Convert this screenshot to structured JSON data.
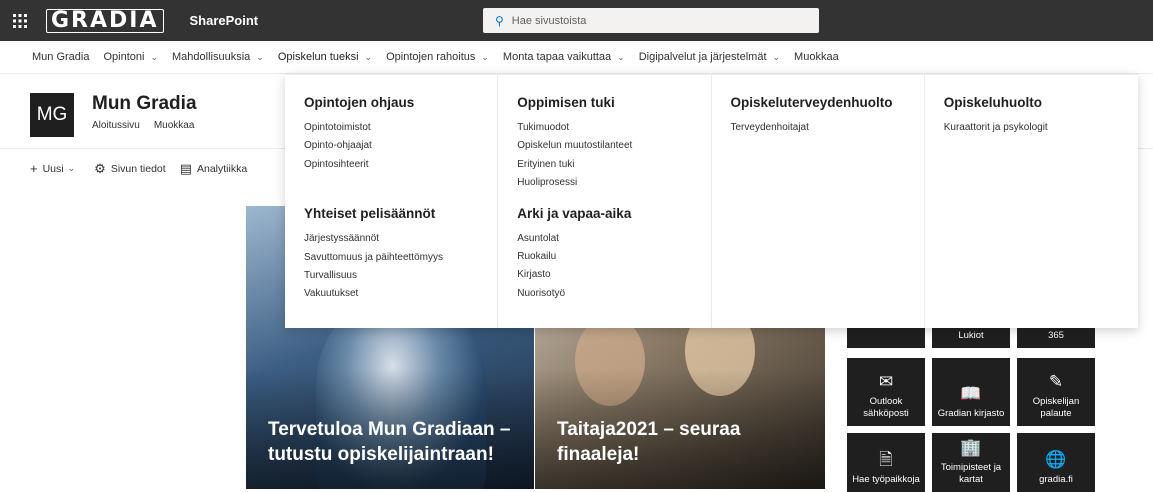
{
  "suitebar": {
    "logo_text": "GRADIA",
    "app_name": "SharePoint",
    "search_placeholder": "Hae sivustoista",
    "bg_color": "#333333"
  },
  "hubnav": {
    "items": [
      {
        "label": "Mun Gradia",
        "has_menu": false
      },
      {
        "label": "Opintoni",
        "has_menu": true
      },
      {
        "label": "Mahdollisuuksia",
        "has_menu": true
      },
      {
        "label": "Opiskelun tueksi",
        "has_menu": true,
        "active": true
      },
      {
        "label": "Opintojen rahoitus",
        "has_menu": true
      },
      {
        "label": "Monta tapaa vaikuttaa",
        "has_menu": true
      },
      {
        "label": "Digipalvelut ja järjestelmät",
        "has_menu": true
      },
      {
        "label": "Muokkaa",
        "has_menu": false
      }
    ]
  },
  "site": {
    "logo_initials": "MG",
    "title": "Mun Gradia",
    "links": [
      "Aloitussivu",
      "Muokkaa"
    ]
  },
  "cmdbar": {
    "new_label": "Uusi",
    "page_details_label": "Sivun tiedot",
    "analytics_label": "Analytiikka"
  },
  "hero": {
    "left_title": "Tervetuloa Mun Gradiaan – tutustu opiskelijaintraan!",
    "right_title": "Taitaja2021 – seuraa finaaleja!"
  },
  "tiles": {
    "row1": [
      "Lukiot",
      "365"
    ],
    "row2": [
      {
        "label": "Outlook sähköposti",
        "icon": "mail-icon"
      },
      {
        "label": "Gradian kirjasto",
        "icon": "book-icon"
      },
      {
        "label": "Opiskelijan palaute",
        "icon": "feedback-icon"
      }
    ],
    "row3": [
      {
        "label": "Hae työpaikkoja",
        "icon": "document-icon"
      },
      {
        "label": "Toimipisteet ja kartat",
        "icon": "building-icon"
      },
      {
        "label": "gradia.fi",
        "icon": "globe-icon"
      }
    ]
  },
  "mega_menu": {
    "columns": [
      {
        "groups": [
          {
            "heading": "Opintojen ohjaus",
            "links": [
              "Opintotoimistot",
              "Opinto-ohjaajat",
              "Opintosihteerit"
            ]
          },
          {
            "heading": "Yhteiset pelisäännöt",
            "links": [
              "Järjestyssäännöt",
              "Savuttomuus ja päihteettömyys",
              "Turvallisuus",
              "Vakuutukset"
            ]
          }
        ]
      },
      {
        "groups": [
          {
            "heading": "Oppimisen tuki",
            "links": [
              "Tukimuodot",
              "Opiskelun muutostilanteet",
              "Erityinen tuki",
              "Huoliprosessi"
            ]
          },
          {
            "heading": "Arki ja vapaa-aika",
            "links": [
              "Asuntolat",
              "Ruokailu",
              "Kirjasto",
              "Nuorisotyö"
            ]
          }
        ]
      },
      {
        "groups": [
          {
            "heading": "Opiskeluterveydenhuolto",
            "links": [
              "Terveydenhoitajat"
            ]
          }
        ]
      },
      {
        "groups": [
          {
            "heading": "Opiskeluhuolto",
            "links": [
              "Kuraattorit ja psykologit"
            ]
          }
        ]
      }
    ]
  }
}
